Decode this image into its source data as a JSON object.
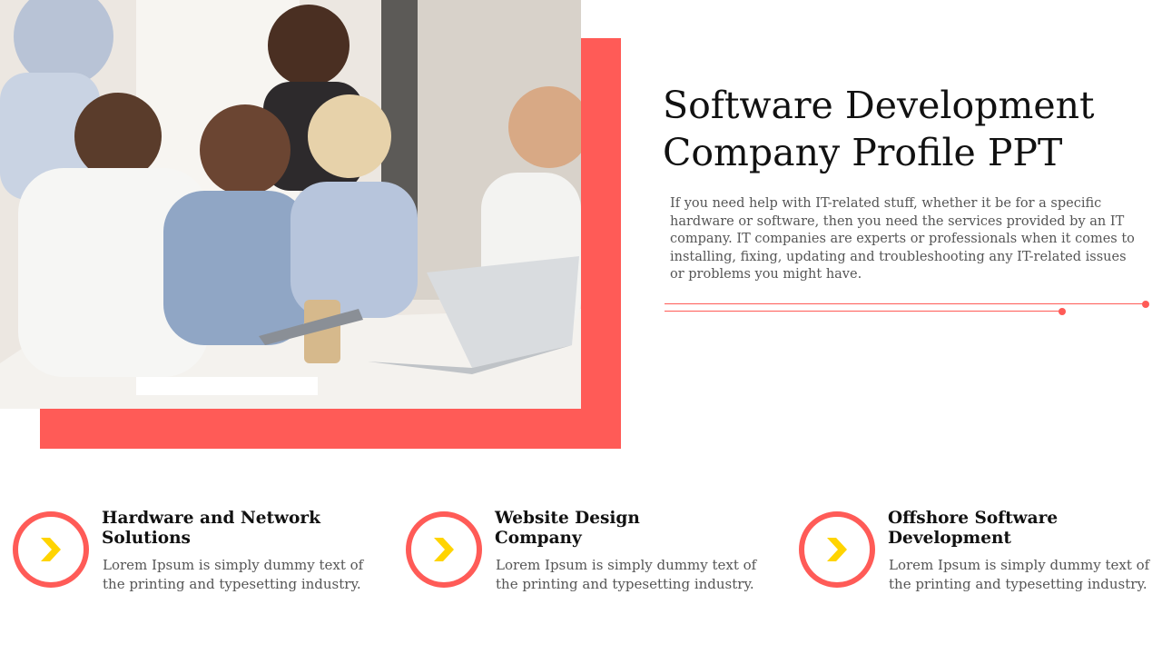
{
  "slide": {
    "title_line1": "Software Development",
    "title_line2": "Company Profile PPT",
    "description": "If you need help with IT-related stuff, whether it be for a specific hardware or software, then you need the services provided by an IT company. IT companies are experts or professionals when it comes to installing, fixing, updating and troubleshooting any IT-related issues or problems you might have.",
    "accent_color": "#ff5b57",
    "chevron_color": "#ffd400"
  },
  "features": [
    {
      "title_line1": "Hardware and Network",
      "title_line2": "Solutions",
      "text_line1": "Lorem Ipsum is simply dummy text of",
      "text_line2": "the printing and typesetting industry.",
      "icon": "chevron-right-icon"
    },
    {
      "title_line1": "Website Design",
      "title_line2": "Company",
      "text_line1": "Lorem Ipsum is simply dummy text of",
      "text_line2": "the printing and typesetting industry.",
      "icon": "chevron-right-icon"
    },
    {
      "title_line1": "Offshore Software",
      "title_line2": "Development",
      "text_line1": "Lorem Ipsum is simply dummy text of",
      "text_line2": "the printing and typesetting industry.",
      "icon": "chevron-right-icon"
    }
  ]
}
